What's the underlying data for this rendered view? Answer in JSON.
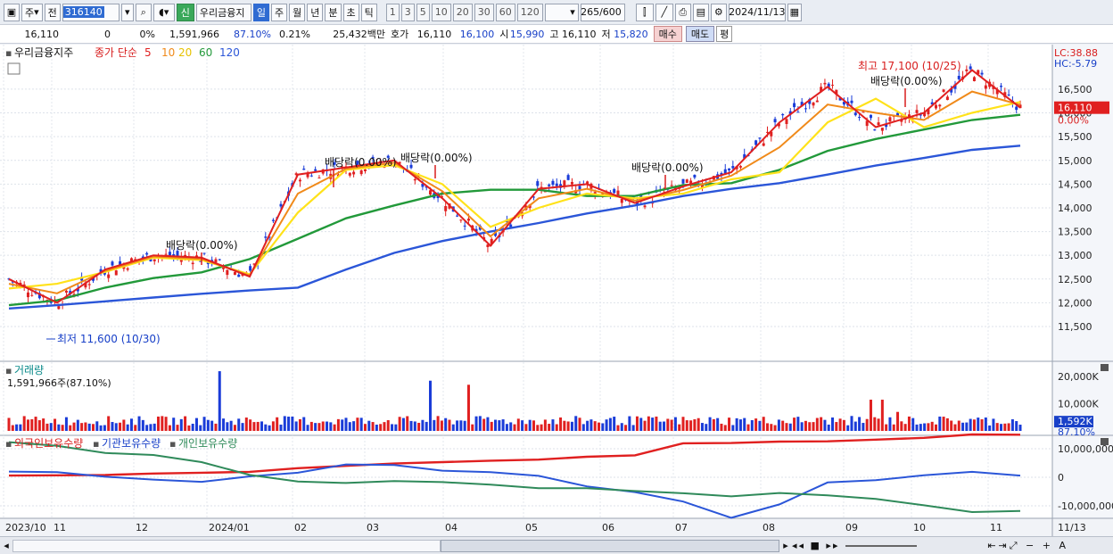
{
  "toolbar": {
    "period_short": "주",
    "mode": "전",
    "code": "316140",
    "name": "우리금융지",
    "new_badge": "신",
    "periods": [
      "일",
      "주",
      "월",
      "년",
      "분",
      "초",
      "틱"
    ],
    "intervals": [
      "1",
      "3",
      "5",
      "10",
      "20",
      "30",
      "60",
      "120"
    ],
    "count": "265",
    "count_max": "/600",
    "date": "2024/11/13"
  },
  "info": {
    "price": "16,110",
    "change": "0",
    "change_pct": "0%",
    "volume": "1,591,966",
    "vol_ratio": "87.10%",
    "turnover": "0.21%",
    "amount": "25,432백만",
    "bid_ask_label": "호가",
    "ask": "16,110",
    "bid": "16,100",
    "open_label": "시",
    "open": "15,990",
    "high_label": "고",
    "high": "16,110",
    "low_label": "저",
    "low": "15,820",
    "buy_btn": "매수",
    "sell_btn": "매도",
    "eval_btn": "평"
  },
  "price_panel": {
    "title": "우리금융지주",
    "ma_label": "종가 단순",
    "ma_periods": [
      "5",
      "10",
      "20",
      "60",
      "120"
    ],
    "lc": "LC:38.88",
    "hc": "HC:-5.79",
    "y_ticks": [
      "16,500",
      "16,000",
      "15,500",
      "15,000",
      "14,500",
      "14,000",
      "13,500",
      "13,000",
      "12,500",
      "12,000",
      "11,500"
    ],
    "current_price": "16,110",
    "current_pct": "0.00%",
    "max_label": "최고 17,100 (10/25)",
    "min_label": "최저 11,600 (10/30)",
    "dividend_label": "배당락(0.00%)"
  },
  "volume_panel": {
    "title": "거래량",
    "value": "1,591,966주(87.10%)",
    "y_ticks": [
      "20,000K",
      "10,000K"
    ],
    "current": "1,592K",
    "current_pct": "87.10%"
  },
  "holding_panel": {
    "titles": [
      "외국인보유수량",
      "기관보유수량",
      "개인보유수량"
    ],
    "y_ticks": [
      "10,000,000",
      "0",
      "-10,000,000"
    ]
  },
  "x_axis": [
    "2023/10",
    "11",
    "12",
    "2024/01",
    "02",
    "03",
    "04",
    "05",
    "06",
    "07",
    "08",
    "09",
    "10",
    "11"
  ],
  "x_end": "11/13",
  "colors": {
    "ma5": "#e02020",
    "ma10": "#f08a1a",
    "ma20": "#ffe21a",
    "ma60": "#22993a",
    "ma120": "#2b56d8",
    "up": "#e02020",
    "down": "#1a3cd8"
  },
  "chart_data": {
    "type": "line",
    "price_range": [
      11500,
      17100
    ],
    "ma120": [
      11880,
      11950,
      12030,
      12110,
      12190,
      12260,
      12320,
      12700,
      13050,
      13300,
      13500,
      13680,
      13880,
      14050,
      14250,
      14400,
      14520,
      14700,
      14890,
      15050,
      15220,
      15310
    ],
    "ma60": [
      11950,
      12050,
      12320,
      12520,
      12640,
      12920,
      13350,
      13780,
      14050,
      14300,
      14380,
      14380,
      14250,
      14250,
      14480,
      14520,
      14800,
      15200,
      15450,
      15650,
      15850,
      15960
    ],
    "ma20": [
      12300,
      12400,
      12650,
      12950,
      12900,
      12600,
      13900,
      14800,
      14900,
      14500,
      13600,
      14000,
      14300,
      14200,
      14300,
      14600,
      14750,
      15800,
      16300,
      15700,
      16000,
      16230
    ],
    "close": [
      12500,
      12000,
      12700,
      13000,
      12950,
      12550,
      14700,
      14850,
      15000,
      14200,
      13200,
      14400,
      14500,
      14100,
      14450,
      14750,
      15800,
      16550,
      15700,
      16000,
      16900,
      16110
    ],
    "foreign": [
      0.6,
      0.7,
      0.8,
      1.3,
      1.6,
      1.9,
      3.2,
      4.0,
      4.8,
      5.3,
      5.8,
      6.2,
      7.2,
      7.7,
      11.9,
      12.0,
      12.5,
      12.6,
      13.2,
      13.8,
      15.0,
      14.9
    ],
    "institution": [
      2.0,
      1.8,
      0.2,
      -0.8,
      -1.6,
      0.3,
      1.6,
      4.5,
      4.3,
      2.3,
      1.8,
      0.5,
      -3.2,
      -5.2,
      -8.5,
      -14.2,
      -9.5,
      -1.8,
      -1.0,
      0.7,
      1.9,
      0.6
    ],
    "individual": [
      12.3,
      11.0,
      8.5,
      7.8,
      5.3,
      0.8,
      -1.5,
      -2.0,
      -1.3,
      -1.7,
      -2.6,
      -3.8,
      -3.8,
      -4.8,
      -5.6,
      -6.7,
      -5.5,
      -6.3,
      -7.6,
      -9.8,
      -12.2,
      -11.8
    ]
  }
}
